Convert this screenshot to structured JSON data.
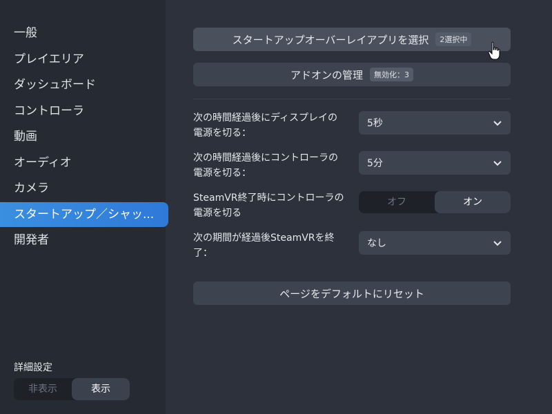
{
  "sidebar": {
    "items": [
      {
        "label": "一般"
      },
      {
        "label": "プレイエリア"
      },
      {
        "label": "ダッシュボード"
      },
      {
        "label": "コントローラ"
      },
      {
        "label": "動画"
      },
      {
        "label": "オーディオ"
      },
      {
        "label": "カメラ"
      },
      {
        "label": "スタートアップ／シャッ..."
      },
      {
        "label": "開発者"
      }
    ],
    "active_index": 7,
    "advanced": {
      "label": "詳細設定",
      "off_label": "非表示",
      "on_label": "表示",
      "selected": "表示"
    }
  },
  "main": {
    "startup_overlay_button": {
      "label": "スタートアップオーバーレイアプリを選択",
      "badge": "2選択中"
    },
    "addons_button": {
      "label": "アドオンの管理",
      "badge": "無効化：3"
    },
    "display_power": {
      "label": "次の時間経過後にディスプレイの電源を切る：",
      "value": "5秒"
    },
    "controller_power": {
      "label": "次の時間経過後にコントローラの電源を切る：",
      "value": "5分"
    },
    "exit_power": {
      "label": "SteamVR終了時にコントローラの電源を切る",
      "off_label": "オフ",
      "on_label": "オン",
      "selected": "オン"
    },
    "idle_exit": {
      "label": "次の期間が経過後SteamVRを終了：",
      "value": "なし"
    },
    "reset_button": {
      "label": "ページをデフォルトにリセット"
    }
  }
}
